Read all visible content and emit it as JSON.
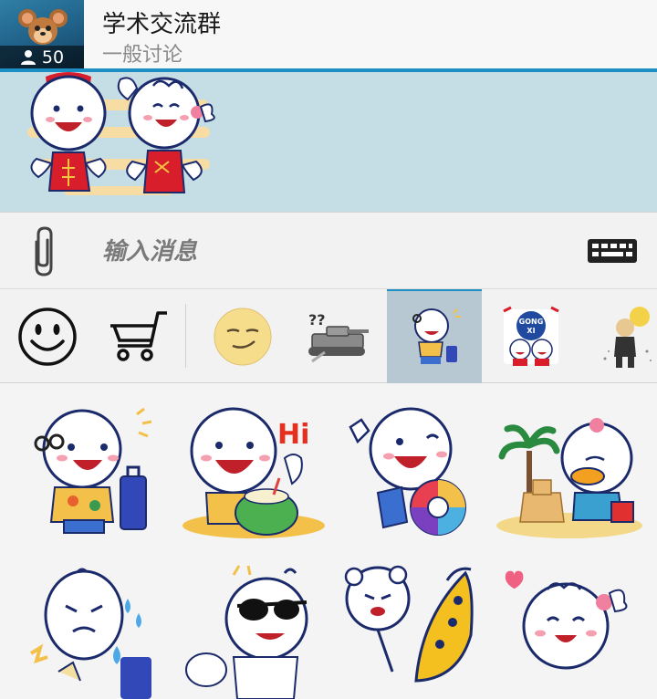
{
  "header": {
    "title": "学术交流群",
    "subtitle": "一般讨论",
    "member_count": "50",
    "icons": [
      "group-avatar",
      "person-icon"
    ]
  },
  "composer": {
    "placeholder": "输入消息",
    "icons": [
      "paperclip-icon",
      "keyboard-icon"
    ]
  },
  "tray": {
    "items": [
      {
        "name": "smiley-icon"
      },
      {
        "name": "shopping-cart-icon"
      },
      {
        "name": "smirk-face-pack"
      },
      {
        "name": "tank-pack"
      },
      {
        "name": "vacation-pack",
        "selected": true
      },
      {
        "name": "gong-xi-pack",
        "label": "GONG XI"
      },
      {
        "name": "bald-man-pack"
      }
    ]
  },
  "grid": {
    "cells": [
      "hi-sunglasses-luggage",
      "hi-coconut",
      "swim-ring",
      "duck-sandcastle",
      "crying",
      "sunglasses",
      "bear-hug",
      "banana-boat",
      "heart-bow"
    ]
  },
  "sticker_text": {
    "hi": "Hi",
    "gong": "GONG",
    "xi": "XI"
  },
  "colors": {
    "accent": "#1c8fc4",
    "chat_bg": "#c5dde5"
  }
}
